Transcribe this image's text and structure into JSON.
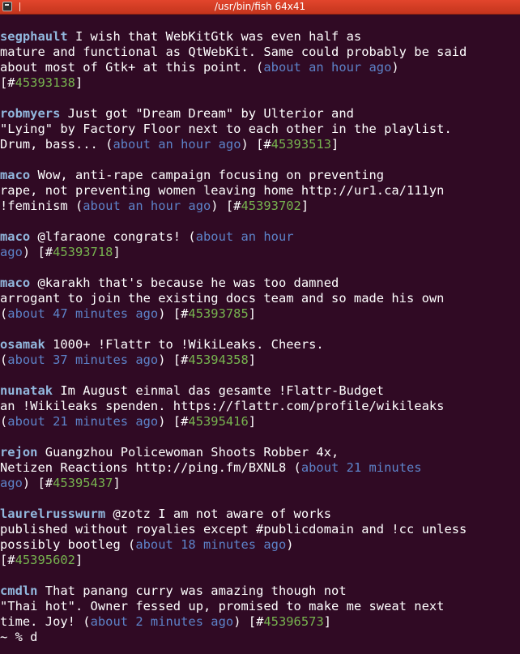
{
  "window": {
    "title": "/usr/bin/fish 64x41"
  },
  "posts": [
    {
      "user": "segphault",
      "lines": [
        [
          {
            "t": "user",
            "v": "segphault"
          },
          {
            "t": "text",
            "v": " I wish that WebKitGtk was even half as"
          }
        ],
        [
          {
            "t": "text",
            "v": "mature and functional as QtWebKit. Same could probably be said"
          }
        ],
        [
          {
            "t": "text",
            "v": "about most of Gtk+ at this point. ("
          },
          {
            "t": "time",
            "v": "about an hour ago"
          },
          {
            "t": "text",
            "v": ")"
          }
        ],
        [
          {
            "t": "text",
            "v": "[#"
          },
          {
            "t": "num",
            "v": "45393138"
          },
          {
            "t": "text",
            "v": "]"
          }
        ]
      ]
    },
    {
      "user": "robmyers",
      "lines": [
        [
          {
            "t": "user",
            "v": "robmyers"
          },
          {
            "t": "text",
            "v": " Just got \"Dream Dream\" by Ulterior and"
          }
        ],
        [
          {
            "t": "text",
            "v": "\"Lying\" by Factory Floor next to each other in the playlist."
          }
        ],
        [
          {
            "t": "text",
            "v": "Drum, bass... ("
          },
          {
            "t": "time",
            "v": "about an hour ago"
          },
          {
            "t": "text",
            "v": ") [#"
          },
          {
            "t": "num",
            "v": "45393513"
          },
          {
            "t": "text",
            "v": "]"
          }
        ]
      ]
    },
    {
      "user": "maco",
      "lines": [
        [
          {
            "t": "user",
            "v": "maco"
          },
          {
            "t": "text",
            "v": " Wow, anti-rape campaign focusing on preventing"
          }
        ],
        [
          {
            "t": "text",
            "v": "rape, not preventing women leaving home http://ur1.ca/111yn"
          }
        ],
        [
          {
            "t": "text",
            "v": "!feminism ("
          },
          {
            "t": "time",
            "v": "about an hour ago"
          },
          {
            "t": "text",
            "v": ") [#"
          },
          {
            "t": "num",
            "v": "45393702"
          },
          {
            "t": "text",
            "v": "]"
          }
        ]
      ]
    },
    {
      "user": "maco",
      "lines": [
        [
          {
            "t": "user",
            "v": "maco"
          },
          {
            "t": "text",
            "v": " @lfaraone congrats! ("
          },
          {
            "t": "time",
            "v": "about an hour"
          }
        ],
        [
          {
            "t": "time",
            "v": "ago"
          },
          {
            "t": "text",
            "v": ") [#"
          },
          {
            "t": "num",
            "v": "45393718"
          },
          {
            "t": "text",
            "v": "]"
          }
        ]
      ]
    },
    {
      "user": "maco",
      "lines": [
        [
          {
            "t": "user",
            "v": "maco"
          },
          {
            "t": "text",
            "v": " @karakh that's because he was too damned"
          }
        ],
        [
          {
            "t": "text",
            "v": "arrogant to join the existing docs team and so made his own"
          }
        ],
        [
          {
            "t": "text",
            "v": "("
          },
          {
            "t": "time",
            "v": "about 47 minutes ago"
          },
          {
            "t": "text",
            "v": ") [#"
          },
          {
            "t": "num",
            "v": "45393785"
          },
          {
            "t": "text",
            "v": "]"
          }
        ]
      ]
    },
    {
      "user": "osamak",
      "lines": [
        [
          {
            "t": "user",
            "v": "osamak"
          },
          {
            "t": "text",
            "v": " 1000+ !Flattr to !WikiLeaks. Cheers."
          }
        ],
        [
          {
            "t": "text",
            "v": "("
          },
          {
            "t": "time",
            "v": "about 37 minutes ago"
          },
          {
            "t": "text",
            "v": ") [#"
          },
          {
            "t": "num",
            "v": "45394358"
          },
          {
            "t": "text",
            "v": "]"
          }
        ]
      ]
    },
    {
      "user": "nunatak",
      "lines": [
        [
          {
            "t": "user",
            "v": "nunatak"
          },
          {
            "t": "text",
            "v": " Im August einmal das gesamte !Flattr-Budget"
          }
        ],
        [
          {
            "t": "text",
            "v": "an !Wikileaks spenden. https://flattr.com/profile/wikileaks"
          }
        ],
        [
          {
            "t": "text",
            "v": "("
          },
          {
            "t": "time",
            "v": "about 21 minutes ago"
          },
          {
            "t": "text",
            "v": ") [#"
          },
          {
            "t": "num",
            "v": "45395416"
          },
          {
            "t": "text",
            "v": "]"
          }
        ]
      ]
    },
    {
      "user": "rejon",
      "lines": [
        [
          {
            "t": "user",
            "v": "rejon"
          },
          {
            "t": "text",
            "v": " Guangzhou Policewoman Shoots Robber 4x,"
          }
        ],
        [
          {
            "t": "text",
            "v": "Netizen Reactions http://ping.fm/BXNL8 ("
          },
          {
            "t": "time",
            "v": "about 21 minutes"
          }
        ],
        [
          {
            "t": "time",
            "v": "ago"
          },
          {
            "t": "text",
            "v": ") [#"
          },
          {
            "t": "num",
            "v": "45395437"
          },
          {
            "t": "text",
            "v": "]"
          }
        ]
      ]
    },
    {
      "user": "laurelrusswurm",
      "lines": [
        [
          {
            "t": "user",
            "v": "laurelrusswurm"
          },
          {
            "t": "text",
            "v": " @zotz I am not aware of works"
          }
        ],
        [
          {
            "t": "text",
            "v": "published without royalies except #publicdomain and !cc unless"
          }
        ],
        [
          {
            "t": "text",
            "v": "possibly bootleg ("
          },
          {
            "t": "time",
            "v": "about 18 minutes ago"
          },
          {
            "t": "text",
            "v": ")"
          }
        ],
        [
          {
            "t": "text",
            "v": "[#"
          },
          {
            "t": "num",
            "v": "45395602"
          },
          {
            "t": "text",
            "v": "]"
          }
        ]
      ]
    },
    {
      "user": "cmdln",
      "lines": [
        [
          {
            "t": "user",
            "v": "cmdln"
          },
          {
            "t": "text",
            "v": " That panang curry was amazing though not"
          }
        ],
        [
          {
            "t": "text",
            "v": "\"Thai hot\". Owner fessed up, promised to make me sweat next"
          }
        ],
        [
          {
            "t": "text",
            "v": "time. Joy! ("
          },
          {
            "t": "time",
            "v": "about 2 minutes ago"
          },
          {
            "t": "text",
            "v": ") [#"
          },
          {
            "t": "num",
            "v": "45396573"
          },
          {
            "t": "text",
            "v": "]"
          }
        ]
      ]
    }
  ],
  "prompt": {
    "text": "~ % d"
  },
  "colors": {
    "background": "#300a24",
    "titlebar": "#d43d25",
    "username": "#92b8de",
    "timestamp": "#5d83c9",
    "notice_id": "#77b44f",
    "text": "#ffffff"
  }
}
